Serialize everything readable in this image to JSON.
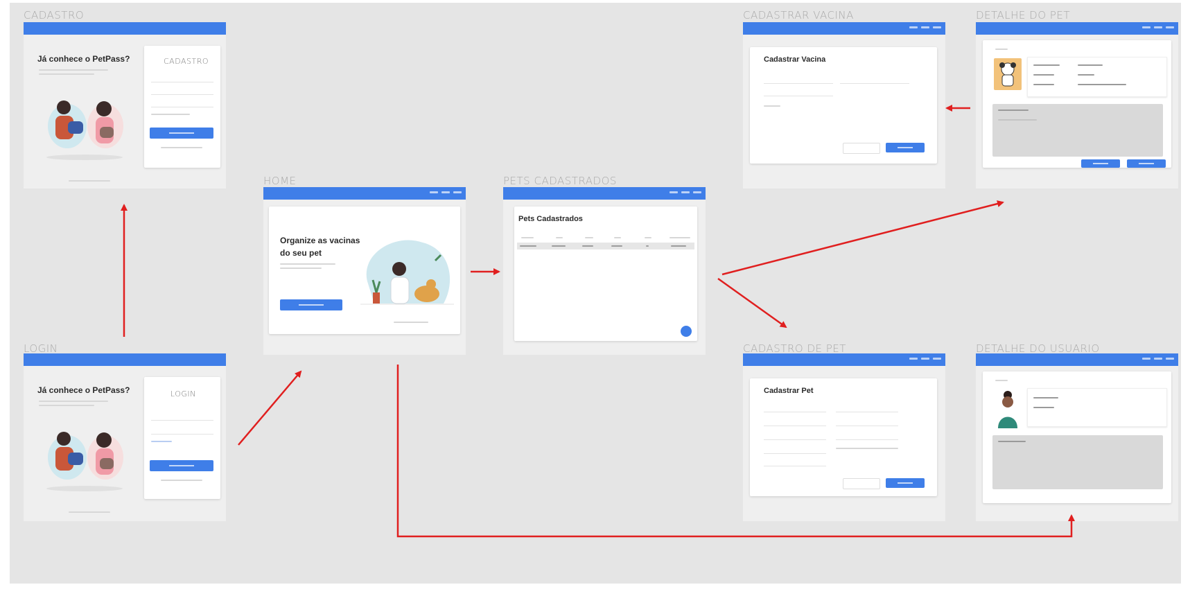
{
  "screens": {
    "cadastro": {
      "label": "CADASTRO",
      "heading": "Já conhece o PetPass?",
      "form_title": "CADASTRO"
    },
    "login": {
      "label": "LOGIN",
      "heading": "Já conhece o PetPass?",
      "form_title": "LOGIN"
    },
    "home": {
      "label": "HOME",
      "headline": "Organize as vacinas do seu pet"
    },
    "pets_cadastrados": {
      "label": "PETS CADASTRADOS",
      "title": "Pets Cadastrados"
    },
    "cadastrar_vacina": {
      "label": "CADASTRAR VACINA",
      "title": "Cadastrar Vacina"
    },
    "detalhe_do_pet": {
      "label": "DETALHE DO PET"
    },
    "cadastro_de_pet": {
      "label": "CADASTRO DE PET",
      "title": "Cadastrar Pet"
    },
    "detalhe_do_usuario": {
      "label": "DETALHE DO USUARIO"
    }
  },
  "colors": {
    "primary": "#3f7ee8",
    "arrow": "#e01f1f",
    "canvas": "#e5e5e5"
  },
  "flows": [
    {
      "from": "login",
      "to": "cadastro"
    },
    {
      "from": "login",
      "to": "home"
    },
    {
      "from": "home",
      "to": "pets_cadastrados"
    },
    {
      "from": "home",
      "to": "detalhe_do_usuario"
    },
    {
      "from": "pets_cadastrados",
      "to": "detalhe_do_pet"
    },
    {
      "from": "pets_cadastrados",
      "to": "cadastro_de_pet"
    },
    {
      "from": "detalhe_do_pet",
      "to": "cadastrar_vacina"
    }
  ]
}
